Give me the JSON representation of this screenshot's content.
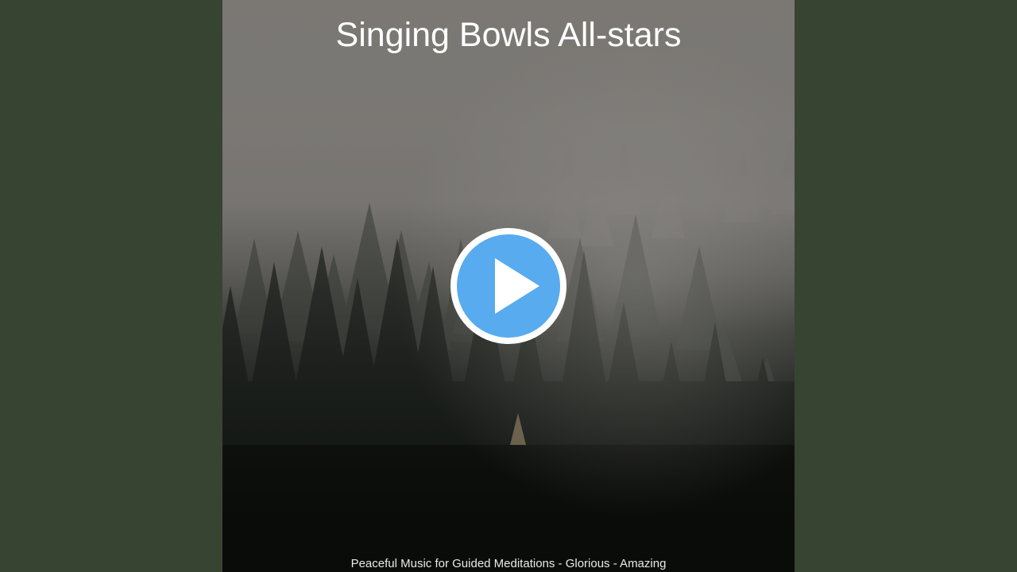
{
  "album": {
    "title": "Singing Bowls All-stars"
  },
  "track": {
    "caption": "Peaceful Music for Guided Meditations - Glorious - Amazing"
  },
  "icons": {
    "play": "play-icon"
  },
  "colors": {
    "background": "#384432",
    "play_accent": "#58abee",
    "forest_dark": "#0b0d0b",
    "fog": "#7b7874"
  }
}
